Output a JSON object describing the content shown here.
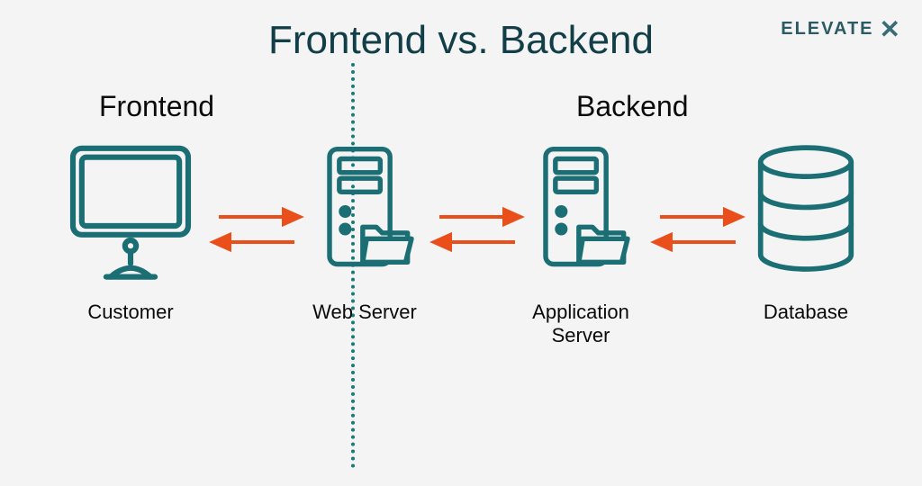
{
  "brand": "ELEVATE",
  "title": "Frontend vs. Backend",
  "sections": {
    "frontend": "Frontend",
    "backend": "Backend"
  },
  "nodes": {
    "customer": {
      "label": "Customer",
      "side": "frontend",
      "icon": "monitor"
    },
    "web_server": {
      "label": "Web Server",
      "side": "backend",
      "icon": "server"
    },
    "application_server": {
      "label": "Application Server",
      "side": "backend",
      "icon": "server"
    },
    "database": {
      "label": "Database",
      "side": "backend",
      "icon": "database"
    }
  },
  "flows": [
    {
      "from": "customer",
      "to": "web_server",
      "bidirectional": true
    },
    {
      "from": "web_server",
      "to": "application_server",
      "bidirectional": true
    },
    {
      "from": "application_server",
      "to": "database",
      "bidirectional": true
    }
  ],
  "colors": {
    "icon": "#1b6e74",
    "arrow": "#e94e1b",
    "bg": "#f4f4f4",
    "text": "#113e47"
  }
}
